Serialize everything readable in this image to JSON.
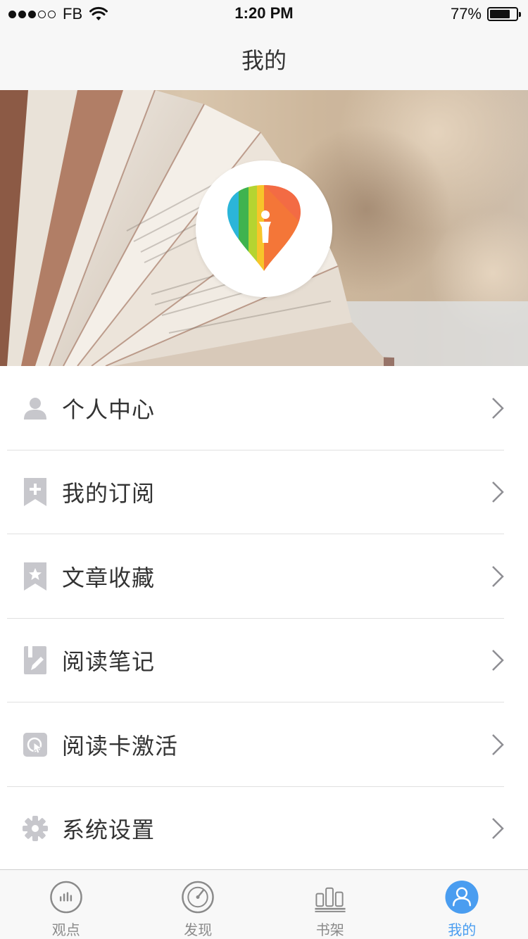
{
  "status_bar": {
    "carrier": "FB",
    "time": "1:20 PM",
    "battery_percent": "77%",
    "battery_level": 0.77,
    "signal_dots_filled": 3,
    "signal_dots_total": 5
  },
  "nav": {
    "title": "我的"
  },
  "hero": {
    "logo_icon": "app-logo-icon"
  },
  "menu": {
    "items": [
      {
        "label": "个人中心",
        "icon": "person-icon"
      },
      {
        "label": "我的订阅",
        "icon": "bookmark-plus-icon"
      },
      {
        "label": "文章收藏",
        "icon": "bookmark-star-icon"
      },
      {
        "label": "阅读笔记",
        "icon": "note-pen-icon"
      },
      {
        "label": "阅读卡激活",
        "icon": "card-cursor-icon"
      },
      {
        "label": "系统设置",
        "icon": "gear-icon"
      }
    ]
  },
  "tab_bar": {
    "tabs": [
      {
        "label": "观点",
        "icon": "viewpoint-icon",
        "active": false
      },
      {
        "label": "发现",
        "icon": "compass-icon",
        "active": false
      },
      {
        "label": "书架",
        "icon": "bookshelf-icon",
        "active": false
      },
      {
        "label": "我的",
        "icon": "profile-icon",
        "active": true
      }
    ]
  },
  "colors": {
    "accent": "#4a9df0",
    "menu_icon_gray": "#c7c7cc",
    "tab_inactive": "#8a8a8a"
  }
}
